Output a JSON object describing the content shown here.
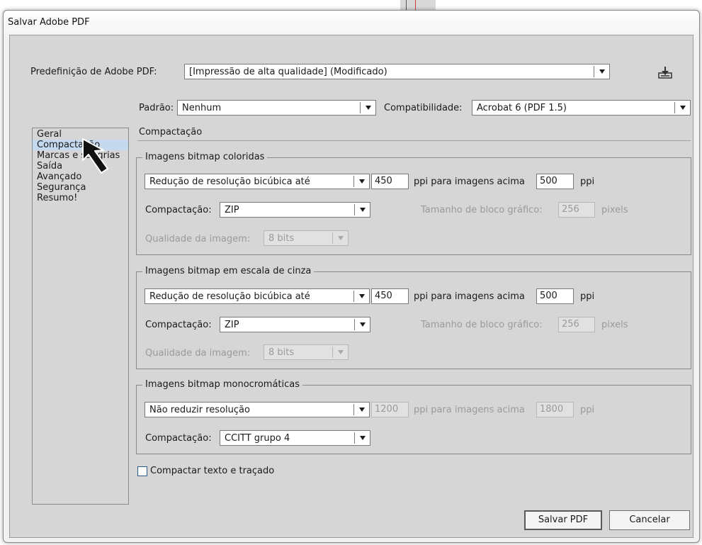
{
  "window": {
    "title": "Salvar Adobe PDF"
  },
  "preset": {
    "label": "Predefinição de Adobe PDF:",
    "value": "[Impressão de alta qualidade] (Modificado)"
  },
  "standard": {
    "label": "Padrão:",
    "value": "Nenhum"
  },
  "compatibility": {
    "label": "Compatibilidade:",
    "value": "Acrobat 6 (PDF 1.5)"
  },
  "sidebar": {
    "items": [
      {
        "label": "Geral"
      },
      {
        "label": "Compactação",
        "selected": true
      },
      {
        "label": "Marcas e sangrias"
      },
      {
        "label": "Saída"
      },
      {
        "label": "Avançado"
      },
      {
        "label": "Segurança"
      },
      {
        "label": "Resumo!"
      }
    ]
  },
  "section": {
    "title": "Compactação"
  },
  "color_images": {
    "title": "Imagens bitmap coloridas",
    "downsample": "Redução de resolução bicúbica até",
    "ppi": "450",
    "ppi_label": "ppi para imagens acima",
    "above": "500",
    "above_unit": "ppi",
    "compression_label": "Compactação:",
    "compression": "ZIP",
    "tile_label": "Tamanho de bloco gráfico:",
    "tile": "256",
    "tile_unit": "pixels",
    "quality_label": "Qualidade da imagem:",
    "quality": "8 bits"
  },
  "gray_images": {
    "title": "Imagens bitmap em escala de cinza",
    "downsample": "Redução de resolução bicúbica até",
    "ppi": "450",
    "ppi_label": "ppi para imagens acima",
    "above": "500",
    "above_unit": "ppi",
    "compression_label": "Compactação:",
    "compression": "ZIP",
    "tile_label": "Tamanho de bloco gráfico:",
    "tile": "256",
    "tile_unit": "pixels",
    "quality_label": "Qualidade da imagem:",
    "quality": "8 bits"
  },
  "mono_images": {
    "title": "Imagens bitmap monocromáticas",
    "downsample": "Não reduzir resolução",
    "ppi": "1200",
    "ppi_label": "ppi para imagens acima",
    "above": "1800",
    "above_unit": "ppi",
    "compression_label": "Compactação:",
    "compression": "CCITT grupo 4"
  },
  "compress_text": {
    "label": "Compactar texto e traçado",
    "checked": false
  },
  "buttons": {
    "save": "Salvar PDF",
    "cancel": "Cancelar"
  },
  "icons": {
    "preset_save": "save-preset-icon",
    "cursor": "mouse-pointer-icon"
  },
  "colors": {
    "selection": "#c4d8ee",
    "checkbox_border": "#2b5a8a",
    "background": "#d6d6d6"
  }
}
